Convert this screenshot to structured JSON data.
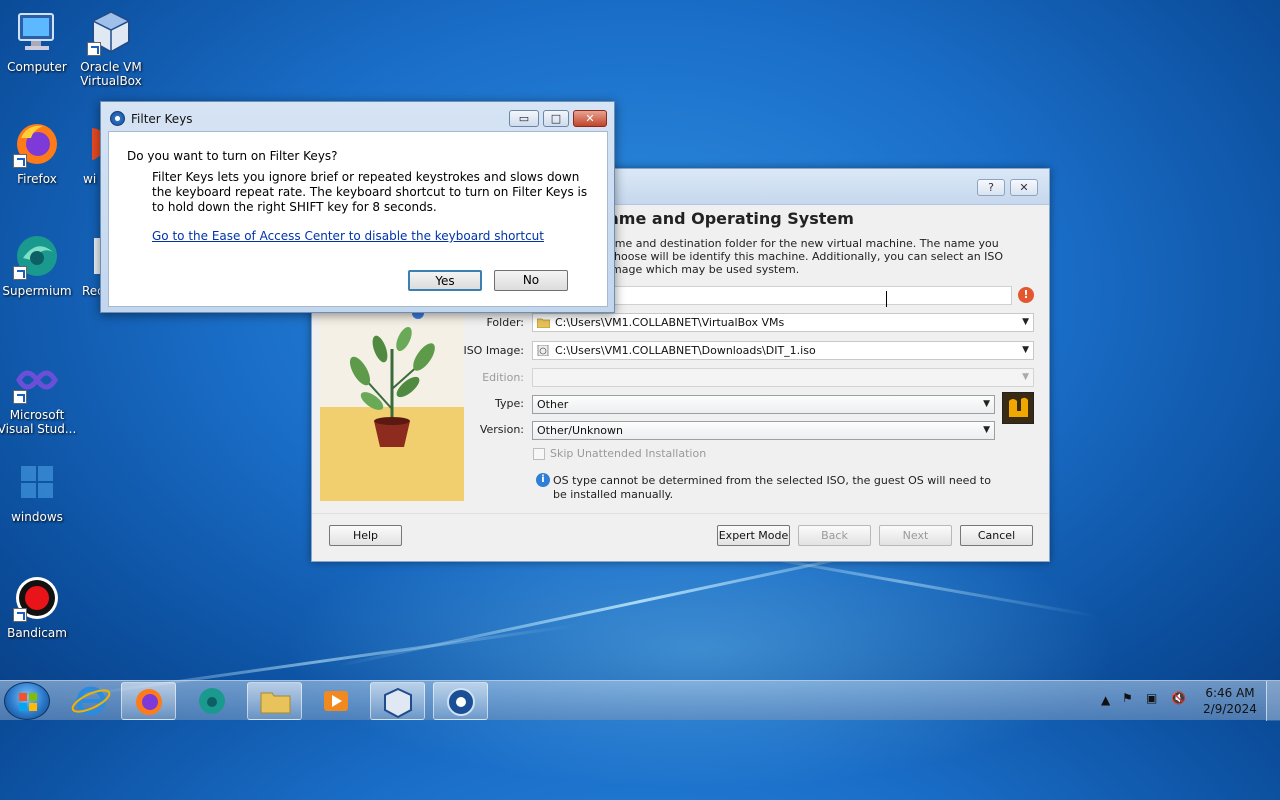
{
  "desktop": {
    "icons": [
      {
        "label": "Computer"
      },
      {
        "label": "Oracle VM VirtualBox"
      },
      {
        "label": "Firefox"
      },
      {
        "label": "wi"
      },
      {
        "label": "Supermium"
      },
      {
        "label": "Rec"
      },
      {
        "label": "Microsoft Visual Stud..."
      },
      {
        "label": "windows"
      },
      {
        "label": "Bandicam"
      }
    ]
  },
  "vbox_wizard": {
    "title_buttons": {
      "help": "?",
      "close": "✕"
    },
    "heading": "ame and Operating System",
    "description": "ame and destination folder for the new virtual machine. The name you choose will be identify this machine. Additionally, you can select an ISO image which may be used system.",
    "fields": {
      "folder_label": "Folder:",
      "folder_value": "C:\\Users\\VM1.COLLABNET\\VirtualBox VMs",
      "iso_label": "ISO Image:",
      "iso_value": "C:\\Users\\VM1.COLLABNET\\Downloads\\DIT_1.iso",
      "edition_label": "Edition:",
      "edition_value": "",
      "type_label": "Type:",
      "type_value": "Other",
      "version_label": "Version:",
      "version_value": "Other/Unknown"
    },
    "skip_unattended_label": "Skip Unattended Installation",
    "info_message": "OS type cannot be determined from the selected ISO, the guest OS will need to be installed manually.",
    "buttons": {
      "help": "Help",
      "expert_mode": "Expert Mode",
      "back": "Back",
      "next": "Next",
      "cancel": "Cancel"
    }
  },
  "filter_keys_dialog": {
    "title": "Filter Keys",
    "question": "Do you want to turn on Filter Keys?",
    "description": "Filter Keys lets you ignore brief or repeated keystrokes and slows down the keyboard repeat rate.  The keyboard shortcut to turn on Filter Keys is to hold down the right SHIFT key for 8 seconds.",
    "link": "Go to the Ease of Access Center to disable the keyboard shortcut",
    "yes": "Yes",
    "no": "No"
  },
  "taskbar": {
    "time": "6:46 AM",
    "date": "2/9/2024"
  },
  "colors": {
    "desktop_blue": "#1a6ec8",
    "link_blue": "#0033aa",
    "close_red": "#c0442b"
  }
}
